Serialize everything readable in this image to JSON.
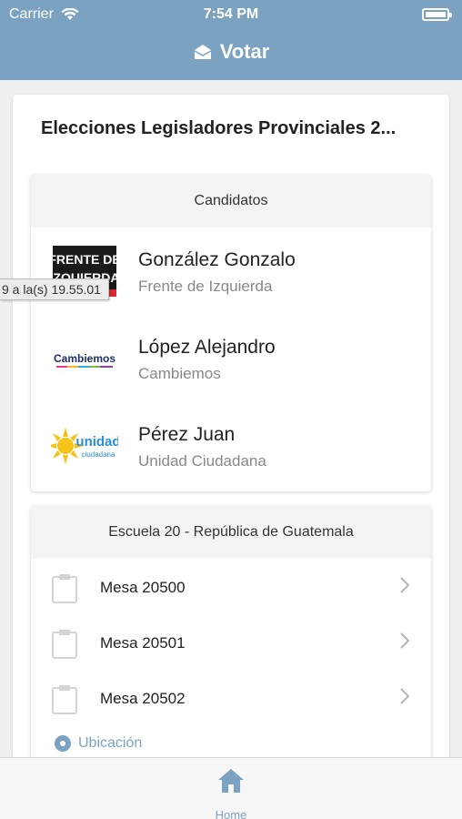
{
  "status_bar": {
    "carrier": "Carrier",
    "time": "7:54 PM",
    "icons": [
      "wifi-icon",
      "battery-icon"
    ]
  },
  "nav": {
    "title": "Votar",
    "icon": "envelope-icon"
  },
  "election": {
    "title": "Elecciones Legisladores Provinciales 2..."
  },
  "candidates_panel": {
    "header": "Candidatos",
    "items": [
      {
        "name": "González Gonzalo",
        "party": "Frente de Izquierda",
        "logo": "frente-de-izquierda-logo",
        "logo_text": [
          "FRENTE DE",
          "IZQUIERDA"
        ]
      },
      {
        "name": "López Alejandro",
        "party": "Cambiemos",
        "logo": "cambiemos-logo",
        "logo_text": [
          "Cambiemos"
        ]
      },
      {
        "name": "Pérez Juan",
        "party": "Unidad Ciudadana",
        "logo": "unidad-ciudadana-logo",
        "logo_text": [
          "unidad",
          "ciudadana"
        ]
      }
    ]
  },
  "school_panel": {
    "header": "Escuela 20 - República de Guatemala",
    "mesas": [
      {
        "label": "Mesa 20500"
      },
      {
        "label": "Mesa 20501"
      },
      {
        "label": "Mesa 20502"
      }
    ],
    "location_label": "Ubicación"
  },
  "tooltip": {
    "text": "9 a la(s) 19.55.01"
  },
  "tab_bar": {
    "home_label": "Home",
    "home_icon": "home-icon"
  },
  "colors": {
    "accent": "#7ba3c1",
    "panel_header_bg": "#f4f4f4",
    "secondary_text": "#888888"
  }
}
